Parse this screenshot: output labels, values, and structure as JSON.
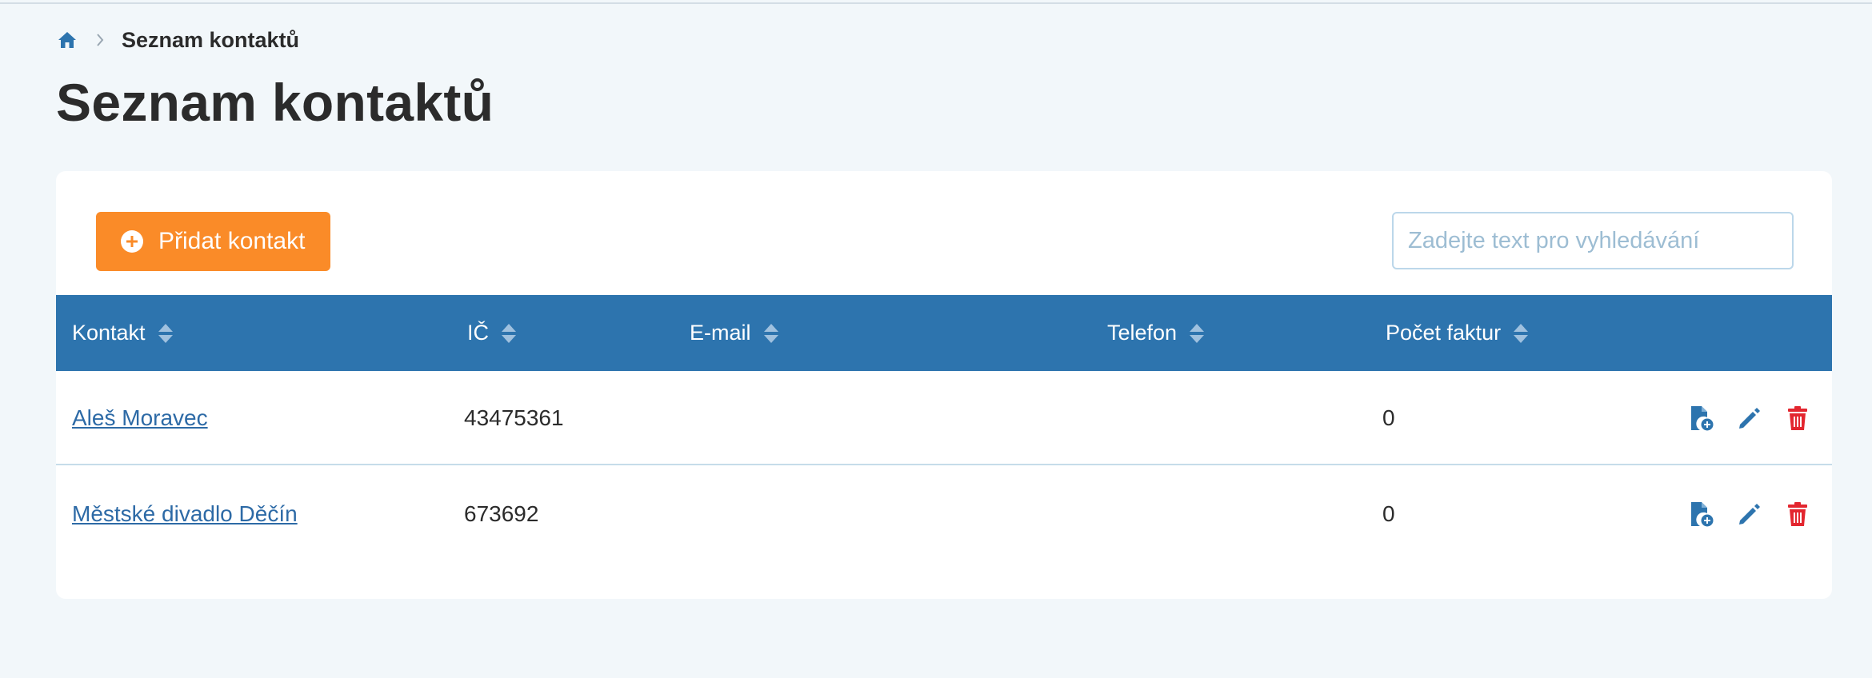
{
  "breadcrumb": {
    "home_icon": "home-icon",
    "separator_icon": "chevron-right-icon",
    "current": "Seznam kontaktů"
  },
  "page": {
    "title": "Seznam kontaktů"
  },
  "toolbar": {
    "add_label": "Přidat kontakt",
    "add_icon": "plus-circle-icon",
    "search_placeholder": "Zadejte text pro vyhledávání",
    "search_value": ""
  },
  "table": {
    "columns": [
      {
        "label": "Kontakt",
        "icon": "sort-icon"
      },
      {
        "label": "IČ",
        "icon": "sort-icon"
      },
      {
        "label": "E-mail",
        "icon": "sort-icon"
      },
      {
        "label": "Telefon",
        "icon": "sort-icon"
      },
      {
        "label": "Počet faktur",
        "icon": "sort-icon"
      }
    ],
    "rows": [
      {
        "contact": "Aleš Moravec",
        "ic": "43475361",
        "email": "",
        "phone": "",
        "invoices": "0"
      },
      {
        "contact": "Městské divadlo Děčín",
        "ic": "673692",
        "email": "",
        "phone": "",
        "invoices": "0"
      }
    ],
    "row_actions": [
      "new-invoice-icon",
      "edit-pencil-icon",
      "delete-trash-icon"
    ]
  },
  "colors": {
    "primary": "#2d74ae",
    "accent_orange": "#fa8b28",
    "danger": "#e3262f",
    "background": "#f2f7fa",
    "link": "#2d6aa6"
  }
}
